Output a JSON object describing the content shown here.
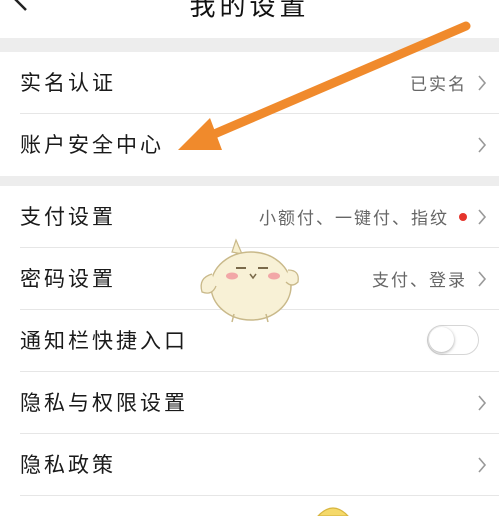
{
  "header": {
    "title": "我的设置"
  },
  "section1": [
    {
      "label": "实名认证",
      "value": "已实名"
    },
    {
      "label": "账户安全中心",
      "value": ""
    }
  ],
  "section2": [
    {
      "label": "支付设置",
      "value": "小额付、一键付、指纹"
    },
    {
      "label": "密码设置",
      "value": "支付、登录"
    },
    {
      "label": "通知栏快捷入口",
      "toggle_on": false
    },
    {
      "label": "隐私与权限设置",
      "value": ""
    },
    {
      "label": "隐私政策",
      "value": ""
    }
  ],
  "colors": {
    "annotation_arrow": "#f08a2c",
    "notice_dot": "#e5342c"
  }
}
